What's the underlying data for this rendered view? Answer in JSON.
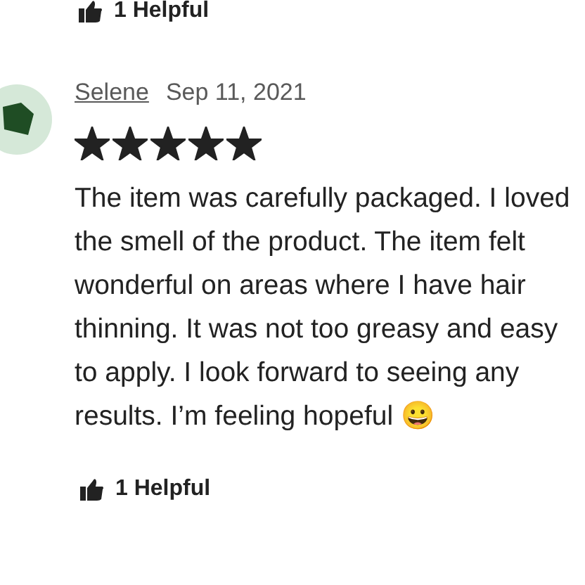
{
  "reviews": [
    {
      "helpful": "1 Helpful"
    },
    {
      "author": "Selene",
      "date": "Sep 11, 2021",
      "stars": 5,
      "text": "The item was carefully packaged. I loved the smell of the product. The item felt wonderful on areas where I have hair thinning. It was not too greasy and easy to apply. I look forward to seeing any results. I’m feeling hopeful 😀",
      "helpful": "1 Helpful"
    }
  ]
}
